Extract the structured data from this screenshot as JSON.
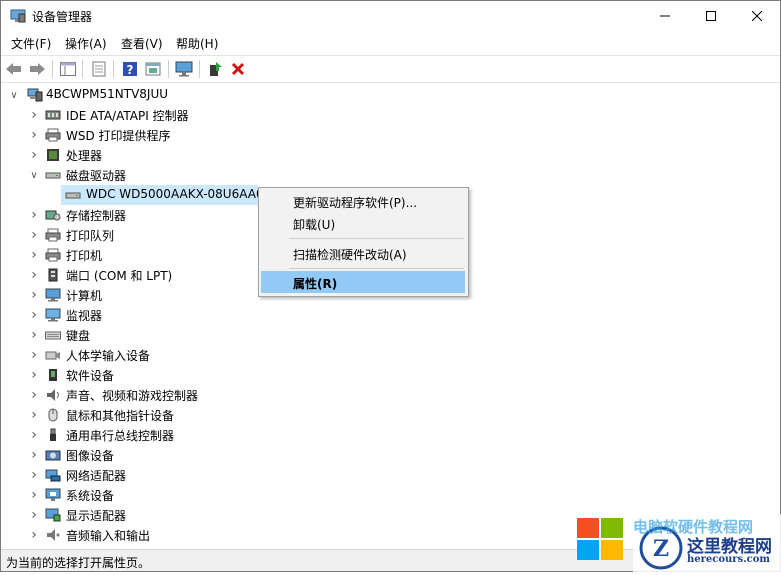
{
  "window": {
    "title": "设备管理器",
    "min_icon": "minimize-icon",
    "max_icon": "maximize-icon",
    "close_icon": "close-icon"
  },
  "menubar": [
    "文件(F)",
    "操作(A)",
    "查看(V)",
    "帮助(H)"
  ],
  "toolbar": [
    "back-arrow-icon",
    "forward-arrow-icon",
    "show-hide-tree-icon",
    "properties-sheet-icon",
    "help-icon",
    "view-toggle-icon",
    "monitor-scan-icon",
    "update-driver-icon",
    "uninstall-x-icon"
  ],
  "tree": {
    "root": "4BCWPM51NTV8JUU",
    "categories": [
      {
        "label": "IDE ATA/ATAPI 控制器",
        "icon": "ide-controller-icon"
      },
      {
        "label": "WSD 打印提供程序",
        "icon": "printer-icon"
      },
      {
        "label": "处理器",
        "icon": "processor-icon"
      },
      {
        "label": "磁盘驱动器",
        "icon": "disk-drive-icon",
        "expanded": true
      },
      {
        "label": "WDC WD5000AAKX-08U6AA0",
        "icon": "disk-drive-icon",
        "child": true,
        "selected": true
      },
      {
        "label": "存储控制器",
        "icon": "storage-controller-icon"
      },
      {
        "label": "打印队列",
        "icon": "printer-icon"
      },
      {
        "label": "打印机",
        "icon": "printer-icon"
      },
      {
        "label": "端口 (COM 和 LPT)",
        "icon": "port-icon"
      },
      {
        "label": "计算机",
        "icon": "computer-icon"
      },
      {
        "label": "监视器",
        "icon": "monitor-icon"
      },
      {
        "label": "键盘",
        "icon": "keyboard-icon"
      },
      {
        "label": "人体学输入设备",
        "icon": "hid-icon"
      },
      {
        "label": "软件设备",
        "icon": "software-device-icon"
      },
      {
        "label": "声音、视频和游戏控制器",
        "icon": "speaker-icon"
      },
      {
        "label": "鼠标和其他指针设备",
        "icon": "mouse-icon"
      },
      {
        "label": "通用串行总线控制器",
        "icon": "usb-icon"
      },
      {
        "label": "图像设备",
        "icon": "camera-icon"
      },
      {
        "label": "网络适配器",
        "icon": "network-adapter-icon"
      },
      {
        "label": "系统设备",
        "icon": "system-device-icon"
      },
      {
        "label": "显示适配器",
        "icon": "display-adapter-icon"
      },
      {
        "label": "音频输入和输出",
        "icon": "audio-io-icon"
      }
    ]
  },
  "context_menu": {
    "update_driver": "更新驱动程序软件(P)...",
    "uninstall": "卸载(U)",
    "scan": "扫描检测硬件改动(A)",
    "properties": "属性(R)"
  },
  "status": "为当前的选择打开属性页。",
  "watermark": {
    "partial_text": "电脑软硬件教程网",
    "site_name": "这里教程网",
    "site_url": "herecours.com"
  },
  "colors": {
    "selection": "#cce8ff",
    "menu_highlight": "#91c9f7",
    "uninstall_red": "#d01414"
  }
}
